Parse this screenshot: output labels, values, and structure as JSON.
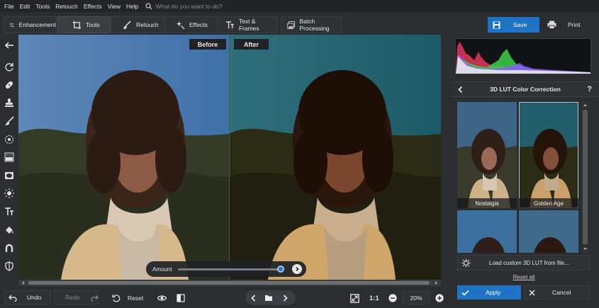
{
  "menu": {
    "items": [
      "File",
      "Edit",
      "Tools",
      "Retouch",
      "Effects",
      "View",
      "Help"
    ],
    "search_placeholder": "What do you want to do?"
  },
  "tabs": [
    {
      "label": "Enhancement",
      "icon": "sliders-icon"
    },
    {
      "label": "Tools",
      "icon": "crop-icon",
      "active": true
    },
    {
      "label": "Retouch",
      "icon": "brush-icon"
    },
    {
      "label": "Effects",
      "icon": "sparkle-icon"
    },
    {
      "label": "Text & Frames",
      "icon": "text-icon"
    },
    {
      "label": "Batch Processing",
      "icon": "images-icon"
    }
  ],
  "actions": {
    "save": "Save",
    "print": "Print"
  },
  "canvas": {
    "before_label": "Before",
    "after_label": "After",
    "amount_label": "Amount",
    "amount_value": 0.98
  },
  "bottom": {
    "undo": "Undo",
    "redo": "Redo",
    "reset": "Reset",
    "zoom_ratio": "1:1",
    "zoom_percent": "20%"
  },
  "panel": {
    "title": "3D LUT Color Correction",
    "help": "?",
    "luts": [
      {
        "label": "Nostalgia",
        "selected": false
      },
      {
        "label": "Golden Age",
        "selected": true
      },
      {
        "label": "",
        "selected": false
      },
      {
        "label": "",
        "selected": false
      }
    ],
    "load_custom": "Load custom 3D LUT from file...",
    "reset_all": "Reset all",
    "apply": "Apply",
    "cancel": "Cancel"
  },
  "colors": {
    "accent": "#1f73c4",
    "background": "#2b2d30",
    "menubar": "#232427"
  }
}
